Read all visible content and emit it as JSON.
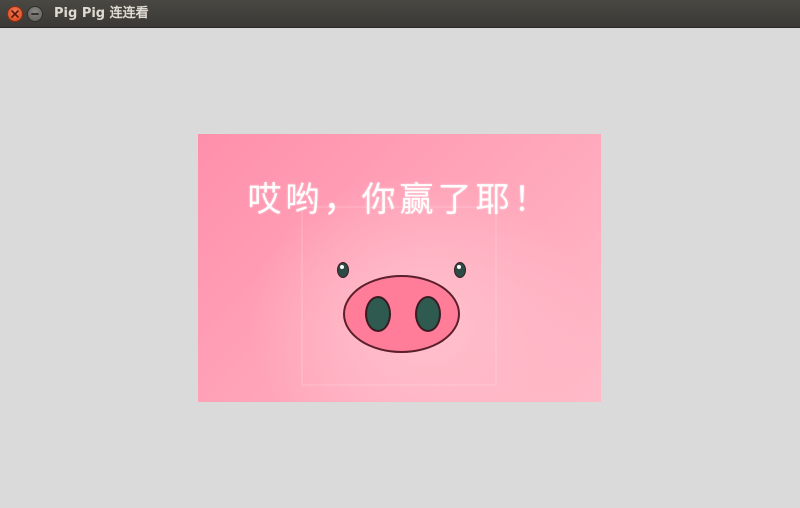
{
  "window": {
    "title": "Pig Pig 连连看"
  },
  "icons": {
    "close": "close-icon",
    "minimize": "minimize-icon"
  },
  "colors": {
    "titlebar": "#3c3b37",
    "background": "#dadada",
    "close_button": "#e2542c",
    "image_pink": "#ffa3b8",
    "snout": "#ff7d99"
  },
  "win_screen": {
    "message": "哎哟，你赢了耶！"
  }
}
